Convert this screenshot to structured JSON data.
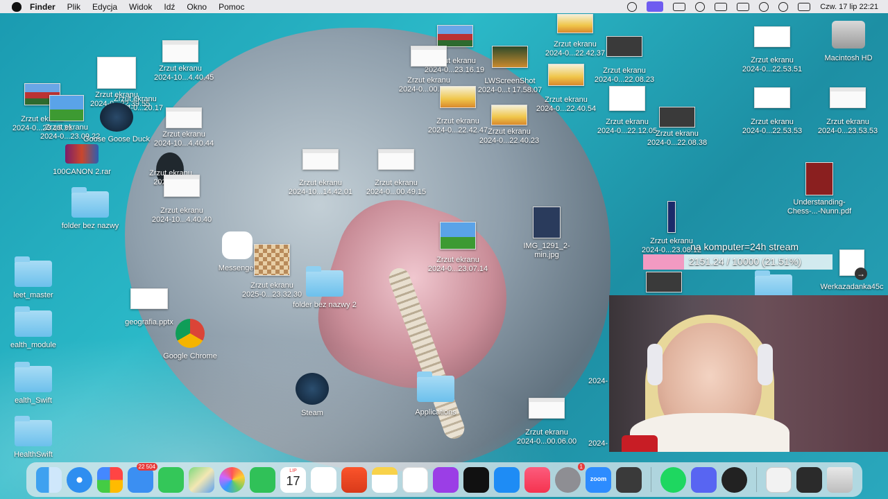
{
  "menubar": {
    "app": "Finder",
    "items": [
      "Plik",
      "Edycja",
      "Widok",
      "Idź",
      "Okno",
      "Pomoc"
    ],
    "clock": "Czw. 17 lip  22:21",
    "status_icons": [
      "screen-share-icon",
      "screen-record-icon",
      "camera-icon",
      "headphones-icon",
      "battery-icon",
      "keyboard-icon",
      "wifi-icon",
      "spotlight-search-icon",
      "control-center-icon"
    ]
  },
  "desktop": {
    "left_labels": [
      "Zrzut ekranu",
      "2024-10...4.40.45",
      "Zrzut ekranu",
      "2024-0...22.39.55",
      "Zrzut ekranu",
      "2024-0...20.17",
      "Zrzut ekranu",
      "2024-0...23.15.31",
      "Zrzut ekranu",
      "2024-0...23.09.22",
      "Goose Goose Duck",
      "Zrzut ekranu",
      "2024-10...4.40.44",
      "100CANON 2.rar",
      "Zrzut ekranu",
      "2024-0...6",
      "Zrzut ekranu",
      "2024-10...4.40.40",
      "folder bez nazwy",
      "Messenger",
      "leet_master",
      "Zrzut ekranu",
      "2025-0...23.32.30",
      "folder bez nazwy 2",
      "geografia.pptx",
      "ealth_module",
      "Google Chrome",
      "ealth_Swift",
      "Steam",
      "Applications",
      "HealthSwift"
    ],
    "center_labels": [
      "Zrzut ekranu",
      "2024-10...14.42.01",
      "Zrzut ekranu",
      "2024-0...00.49.15",
      "Zrzut ekranu",
      "2024-0...23.07.14",
      "IMG_1291_2-",
      "min.jpg",
      "Zrzut ekranu",
      "2024-0...23.16.19",
      "LWScreenShot",
      "2024-0...t 17.58.07",
      "Zrzut ekranu",
      "2024-0...00.51.05",
      "Zrzut ekranu",
      "2024-0...22.42.47",
      "Zrzut ekranu",
      "2024-0...22.40.23",
      "Zrzut ekranu",
      "2024-0...22.42.37",
      "Zrzut ekranu",
      "2024-0...22.40.54",
      "Zrzut ekranu",
      "2024-0...22.08.23",
      "Zrzut ekranu",
      "2024-0...22.12.05",
      "Zrzut ekranu",
      "2024-0...22.08.38"
    ],
    "right_labels": [
      "Zrzut ekranu",
      "2024-0...22.53.51",
      "Macintosh HD",
      "Zrzut ekranu",
      "2024-0...22.53.53",
      "Zrzut ekranu",
      "2024-0...23.53.53",
      "Understanding-",
      "Chess-...-Nunn.pdf",
      "Zrzut ekranu",
      "2024-0...23.08.12",
      "Werkazadanka45c",
      "Zrzut ekranu",
      "2024-0...00.06.00",
      "2024-",
      "2024-"
    ]
  },
  "overlay": {
    "title": "na komputer=24h stream",
    "progress_text": "2151.24 / 10000 (21.51%)",
    "progress_fraction": 0.2151,
    "progress_color": "#f29ac2"
  },
  "dock": {
    "items": [
      "finder-icon",
      "safari-icon",
      "launchpad-icon",
      "mail-icon",
      "messages-icon",
      "maps-icon",
      "photos-icon",
      "facetime-icon",
      "calendar-icon",
      "reminders-icon",
      "brave-icon",
      "notes-icon",
      "freeform-icon",
      "podcasts-icon",
      "apple-tv-icon",
      "app-store-icon",
      "music-icon",
      "system-settings-icon",
      "zoom-icon",
      "chess-icon",
      "spotify-icon",
      "discord-icon",
      "obs-icon",
      "document-icon",
      "terminal-icon",
      "trash-icon"
    ],
    "mail_badge": "22 504",
    "settings_badge": "1",
    "calendar_month": "LIP",
    "calendar_day": "17",
    "zoom_label": "zoom"
  }
}
